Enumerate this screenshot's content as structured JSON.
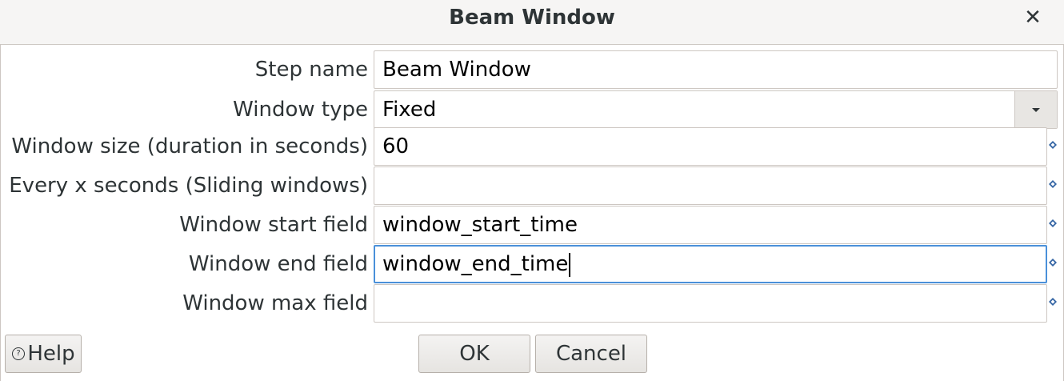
{
  "window": {
    "title": "Beam Window",
    "close_icon": "✕"
  },
  "fields": [
    {
      "label": "Step name",
      "value": "Beam Window"
    },
    {
      "label": "Window type",
      "value": "Fixed"
    },
    {
      "label": "Window size (duration in seconds)",
      "value": "60"
    },
    {
      "label": "Every x seconds (Sliding windows)",
      "value": ""
    },
    {
      "label": "Window start field",
      "value": "window_start_time"
    },
    {
      "label": "Window end field",
      "value": "window_end_time"
    },
    {
      "label": "Window max field",
      "value": ""
    }
  ],
  "buttons": {
    "help": "Help",
    "ok": "OK",
    "cancel": "Cancel"
  },
  "colors": {
    "focus": "#4a90d9",
    "variable_icon": "#3465a4"
  },
  "icons": [
    "close-icon",
    "dropdown-arrow-icon",
    "variable-icon",
    "help-icon"
  ]
}
